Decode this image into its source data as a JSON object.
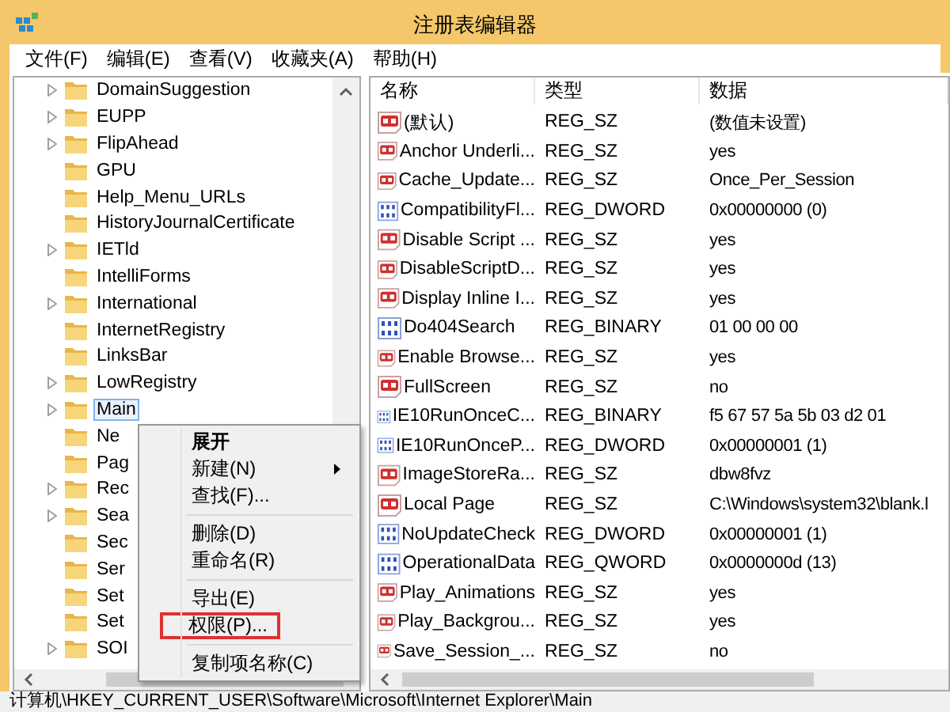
{
  "window": {
    "title": "注册表编辑器"
  },
  "menu_bar": [
    "文件(F)",
    "编辑(E)",
    "查看(V)",
    "收藏夹(A)",
    "帮助(H)"
  ],
  "tree": {
    "items": [
      {
        "label": "DomainSuggestion",
        "expandable": true,
        "selected": false
      },
      {
        "label": "EUPP",
        "expandable": true,
        "selected": false
      },
      {
        "label": "FlipAhead",
        "expandable": true,
        "selected": false
      },
      {
        "label": "GPU",
        "expandable": false,
        "selected": false
      },
      {
        "label": "Help_Menu_URLs",
        "expandable": false,
        "selected": false
      },
      {
        "label": "HistoryJournalCertificate",
        "expandable": false,
        "selected": false
      },
      {
        "label": "IETld",
        "expandable": true,
        "selected": false
      },
      {
        "label": "IntelliForms",
        "expandable": false,
        "selected": false
      },
      {
        "label": "International",
        "expandable": true,
        "selected": false
      },
      {
        "label": "InternetRegistry",
        "expandable": false,
        "selected": false
      },
      {
        "label": "LinksBar",
        "expandable": false,
        "selected": false
      },
      {
        "label": "LowRegistry",
        "expandable": true,
        "selected": false
      },
      {
        "label": "Main",
        "expandable": true,
        "selected": true
      },
      {
        "label": "Ne",
        "expandable": false,
        "selected": false
      },
      {
        "label": "Pag",
        "expandable": false,
        "selected": false
      },
      {
        "label": "Rec",
        "expandable": true,
        "selected": false
      },
      {
        "label": "Sea",
        "expandable": true,
        "selected": false
      },
      {
        "label": "Sec",
        "expandable": false,
        "selected": false
      },
      {
        "label": "Ser",
        "expandable": false,
        "selected": false
      },
      {
        "label": "Set",
        "expandable": false,
        "selected": false
      },
      {
        "label": "Set",
        "expandable": false,
        "selected": false
      },
      {
        "label": "SOI",
        "expandable": true,
        "selected": false
      }
    ]
  },
  "values": {
    "columns": [
      "名称",
      "类型",
      "数据"
    ],
    "rows": [
      {
        "kind": "string",
        "name": "(默认)",
        "type": "REG_SZ",
        "data": "(数值未设置)"
      },
      {
        "kind": "string",
        "name": "Anchor Underli...",
        "type": "REG_SZ",
        "data": "yes"
      },
      {
        "kind": "string",
        "name": "Cache_Update...",
        "type": "REG_SZ",
        "data": "Once_Per_Session"
      },
      {
        "kind": "binary",
        "name": "CompatibilityFl...",
        "type": "REG_DWORD",
        "data": "0x00000000 (0)"
      },
      {
        "kind": "string",
        "name": "Disable Script ...",
        "type": "REG_SZ",
        "data": "yes"
      },
      {
        "kind": "string",
        "name": "DisableScriptD...",
        "type": "REG_SZ",
        "data": "yes"
      },
      {
        "kind": "string",
        "name": "Display Inline I...",
        "type": "REG_SZ",
        "data": "yes"
      },
      {
        "kind": "binary",
        "name": "Do404Search",
        "type": "REG_BINARY",
        "data": "01 00 00 00"
      },
      {
        "kind": "string",
        "name": "Enable Browse...",
        "type": "REG_SZ",
        "data": "yes"
      },
      {
        "kind": "string",
        "name": "FullScreen",
        "type": "REG_SZ",
        "data": "no"
      },
      {
        "kind": "binary",
        "name": "IE10RunOnceC...",
        "type": "REG_BINARY",
        "data": "f5 67 57 5a 5b 03 d2 01"
      },
      {
        "kind": "binary",
        "name": "IE10RunOnceP...",
        "type": "REG_DWORD",
        "data": "0x00000001 (1)"
      },
      {
        "kind": "string",
        "name": "ImageStoreRa...",
        "type": "REG_SZ",
        "data": "dbw8fvz"
      },
      {
        "kind": "string",
        "name": "Local Page",
        "type": "REG_SZ",
        "data": "C:\\Windows\\system32\\blank.l"
      },
      {
        "kind": "binary",
        "name": "NoUpdateCheck",
        "type": "REG_DWORD",
        "data": "0x00000001 (1)"
      },
      {
        "kind": "binary",
        "name": "OperationalData",
        "type": "REG_QWORD",
        "data": "0x0000000d (13)"
      },
      {
        "kind": "string",
        "name": "Play_Animations",
        "type": "REG_SZ",
        "data": "yes"
      },
      {
        "kind": "string",
        "name": "Play_Backgrou...",
        "type": "REG_SZ",
        "data": "yes"
      },
      {
        "kind": "string",
        "name": "Save_Session_...",
        "type": "REG_SZ",
        "data": "no"
      }
    ]
  },
  "context_menu": {
    "items": [
      {
        "kind": "item",
        "label": "展开",
        "bold": true,
        "submenu": false,
        "highlighted": false
      },
      {
        "kind": "item",
        "label": "新建(N)",
        "bold": false,
        "submenu": true,
        "highlighted": false
      },
      {
        "kind": "item",
        "label": "查找(F)...",
        "bold": false,
        "submenu": false,
        "highlighted": false
      },
      {
        "kind": "separator"
      },
      {
        "kind": "item",
        "label": "删除(D)",
        "bold": false,
        "submenu": false,
        "highlighted": false
      },
      {
        "kind": "item",
        "label": "重命名(R)",
        "bold": false,
        "submenu": false,
        "highlighted": false
      },
      {
        "kind": "separator"
      },
      {
        "kind": "item",
        "label": "导出(E)",
        "bold": false,
        "submenu": false,
        "highlighted": false
      },
      {
        "kind": "item",
        "label": "权限(P)...",
        "bold": false,
        "submenu": false,
        "highlighted": true
      },
      {
        "kind": "separator"
      },
      {
        "kind": "item",
        "label": "复制项名称(C)",
        "bold": false,
        "submenu": false,
        "highlighted": false
      }
    ]
  },
  "status_bar": "计算机\\HKEY_CURRENT_USER\\Software\\Microsoft\\Internet Explorer\\Main"
}
